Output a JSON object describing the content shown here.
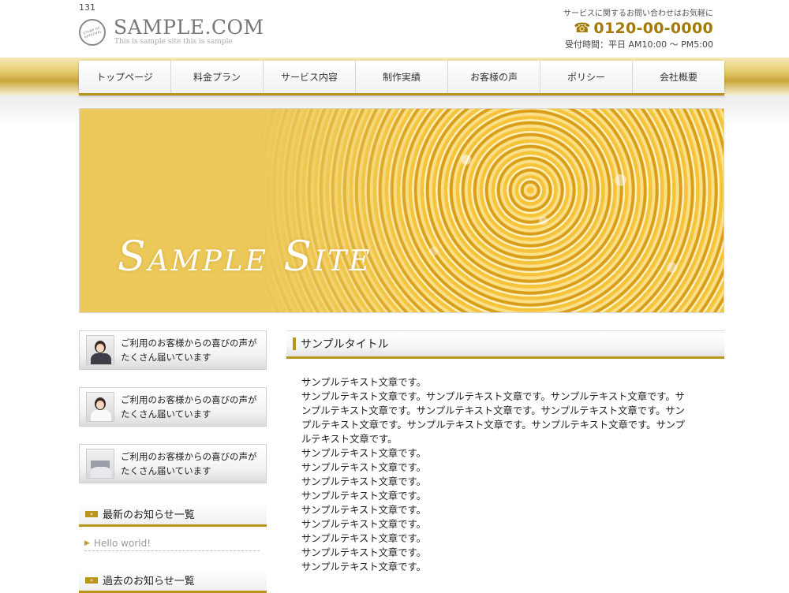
{
  "page_number": "131",
  "header": {
    "logo_name": "SAMPLE.COM",
    "logo_subtitle": "This is sample site this is sample",
    "stamp_text": "STAMP OF APPROVAL",
    "contact_lead": "サービスに関するお問い合わせはお気軽に",
    "phone": "0120-00-0000",
    "hours": "受付時間：平日 AM10:00 ～ PM5:00"
  },
  "nav": [
    "トップページ",
    "料金プラン",
    "サービス内容",
    "制作実績",
    "お客様の声",
    "ポリシー",
    "会社概要"
  ],
  "hero": {
    "title": "Sample Site"
  },
  "sidebar": {
    "banners": [
      {
        "text1": "ご利用のお客様からの喜びの声が",
        "text2": "たくさん届いています"
      },
      {
        "text1": "ご利用のお客様からの喜びの声が",
        "text2": "たくさん届いています"
      },
      {
        "text1": "ご利用のお客様からの喜びの声が",
        "text2": "たくさん届いています"
      }
    ],
    "news_heading": "最新のお知らせ一覧",
    "news_items": [
      "Hello world!"
    ],
    "archive_heading": "過去のお知らせ一覧"
  },
  "main": {
    "title": "サンプルタイトル",
    "lines": [
      "サンプルテキスト文章です。",
      "サンプルテキスト文章です。サンプルテキスト文章です。サンプルテキスト文章です。サ",
      "ンプルテキスト文章です。サンプルテキスト文章です。サンプルテキスト文章です。サン",
      "プルテキスト文章です。サンプルテキスト文章です。サンプルテキスト文章です。サンプ",
      "ルテキスト文章です。",
      "サンプルテキスト文章です。",
      "サンプルテキスト文章です。",
      "サンプルテキスト文章です。",
      "サンプルテキスト文章です。",
      "サンプルテキスト文章です。",
      "サンプルテキスト文章です。",
      "サンプルテキスト文章です。",
      "サンプルテキスト文章です。",
      "サンプルテキスト文章です。"
    ]
  },
  "colors": {
    "accent_gold": "#b8951b",
    "phone_gold": "#a47a07"
  }
}
